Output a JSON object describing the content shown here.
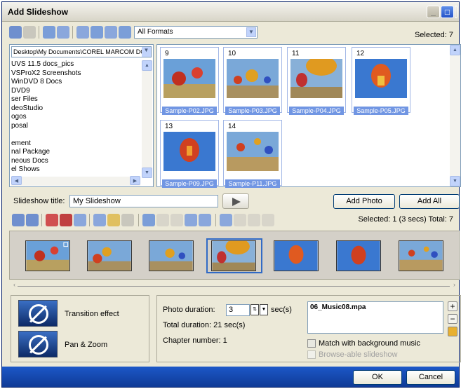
{
  "window": {
    "title": "Add Slideshow"
  },
  "toolbar": {
    "format_select": "All Formats",
    "selected_label": "Selected: 7"
  },
  "folders": {
    "path": "Desktop\\My Documents\\COREL MARCOM DO(",
    "items": [
      "UVS 11.5 docs_pics",
      "VSProX2 Screenshots",
      "WinDVD 8 Docs",
      "DVD9",
      "ser Files",
      "deoStudio",
      "ogos",
      "posal",
      "",
      "ement",
      "nal Package",
      "neous Docs",
      "el Shows"
    ]
  },
  "thumbnails": [
    {
      "num": "9",
      "file": "Sample-P02.JPG"
    },
    {
      "num": "10",
      "file": "Sample-P03.JPG"
    },
    {
      "num": "11",
      "file": "Sample-P04.JPG"
    },
    {
      "num": "12",
      "file": "Sample-P05.JPG"
    },
    {
      "num": "13",
      "file": "Sample-P09.JPG"
    },
    {
      "num": "14",
      "file": "Sample-P11.JPG"
    }
  ],
  "slideshow": {
    "title_label": "Slideshow title:",
    "title_value": "My Slideshow",
    "add_photo": "Add Photo",
    "add_all": "Add All",
    "selected_summary": "Selected: 1 (3 secs)  Total: 7"
  },
  "effects": {
    "transition": "Transition effect",
    "panzoom": "Pan & Zoom"
  },
  "duration": {
    "photo_label": "Photo duration:",
    "photo_value": "3",
    "unit": "sec(s)",
    "total": "Total duration: 21 sec(s)",
    "chapter": "Chapter number: 1"
  },
  "music": {
    "file": "06_Music08.mpa",
    "match_label": "Match with background music",
    "browse_label": "Browse-able slideshow"
  },
  "footer": {
    "ok": "OK",
    "cancel": "Cancel"
  }
}
